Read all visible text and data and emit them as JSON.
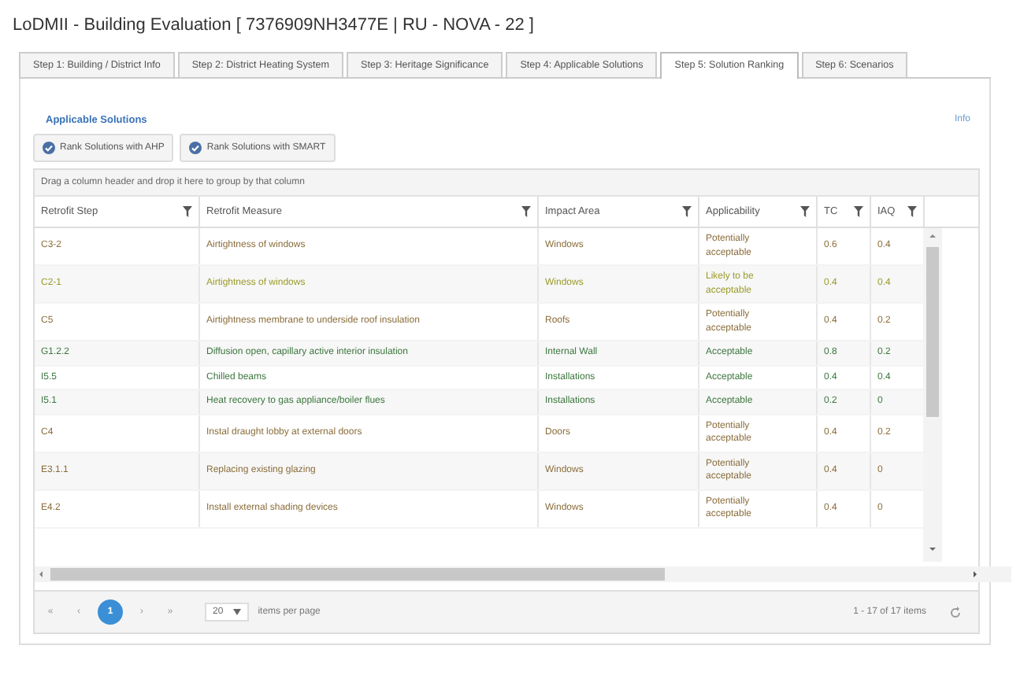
{
  "window": {
    "title": "LoDMII - Building Evaluation [ 7376909NH3477E | RU - NOVA - 22 ]"
  },
  "tabs": [
    {
      "label": "Step 1: Building / District Info",
      "selected": false
    },
    {
      "label": "Step 2: District Heating System",
      "selected": false
    },
    {
      "label": "Step 3: Heritage Significance",
      "selected": false
    },
    {
      "label": "Step 4: Applicable Solutions",
      "selected": false
    },
    {
      "label": "Step 5: Solution Ranking",
      "selected": true
    },
    {
      "label": "Step 6: Scenarios",
      "selected": false
    }
  ],
  "section": {
    "title": "Applicable Solutions",
    "info_link": "Info"
  },
  "buttons": [
    "Rank Solutions with AHP",
    "Rank Solutions with SMART"
  ],
  "group_hint": "Drag a column header and drop it here to group by that column",
  "table": {
    "columns": [
      "Retrofit Step",
      "Retrofit Measure",
      "Impact Area",
      "Applicability",
      "TC",
      "IAQ"
    ],
    "rows": [
      {
        "color": "#8a6d3b",
        "cells": [
          "C3-2",
          "Airtightness of windows",
          "Windows",
          "Potentially acceptable",
          "0.6",
          "0.4"
        ]
      },
      {
        "color": "#9a9a2a",
        "cells": [
          "C2-1",
          "Airtightness of windows",
          "Windows",
          "Likely to be acceptable",
          "0.4",
          "0.4"
        ]
      },
      {
        "color": "#8a6d3b",
        "cells": [
          "C5",
          "Airtightness membrane to underside roof insulation",
          "Roofs",
          "Potentially acceptable",
          "0.4",
          "0.2"
        ]
      },
      {
        "color": "#3c763d",
        "cells": [
          "G1.2.2",
          "Diffusion open, capillary active interior insulation",
          "Internal Wall",
          "Acceptable",
          "0.8",
          "0.2"
        ]
      },
      {
        "color": "#3c763d",
        "cells": [
          "I5.5",
          "Chilled beams",
          "Installations",
          "Acceptable",
          "0.4",
          "0.4"
        ]
      },
      {
        "color": "#3c763d",
        "cells": [
          "I5.1",
          "Heat recovery to gas appliance/boiler flues",
          "Installations",
          "Acceptable",
          "0.2",
          "0"
        ]
      },
      {
        "color": "#8a6d3b",
        "cells": [
          "C4",
          "Instal draught lobby at external doors",
          "Doors",
          "Potentially acceptable",
          "0.4",
          "0.2"
        ]
      },
      {
        "color": "#8a6d3b",
        "cells": [
          "E3.1.1",
          "Replacing existing glazing",
          "Windows",
          "Potentially acceptable",
          "0.4",
          "0"
        ]
      },
      {
        "color": "#8a6d3b",
        "cells": [
          "E4.2",
          "Install external shading devices",
          "Windows",
          "Potentially acceptable",
          "0.4",
          "0"
        ]
      }
    ]
  },
  "pager": {
    "first": "«",
    "prev": "‹",
    "pages": [
      {
        "label": "1",
        "selected": true
      }
    ],
    "next": "›",
    "last": "»",
    "page_size": "20",
    "page_size_label": "items per page",
    "summary": "1 - 17 of 17 items"
  }
}
